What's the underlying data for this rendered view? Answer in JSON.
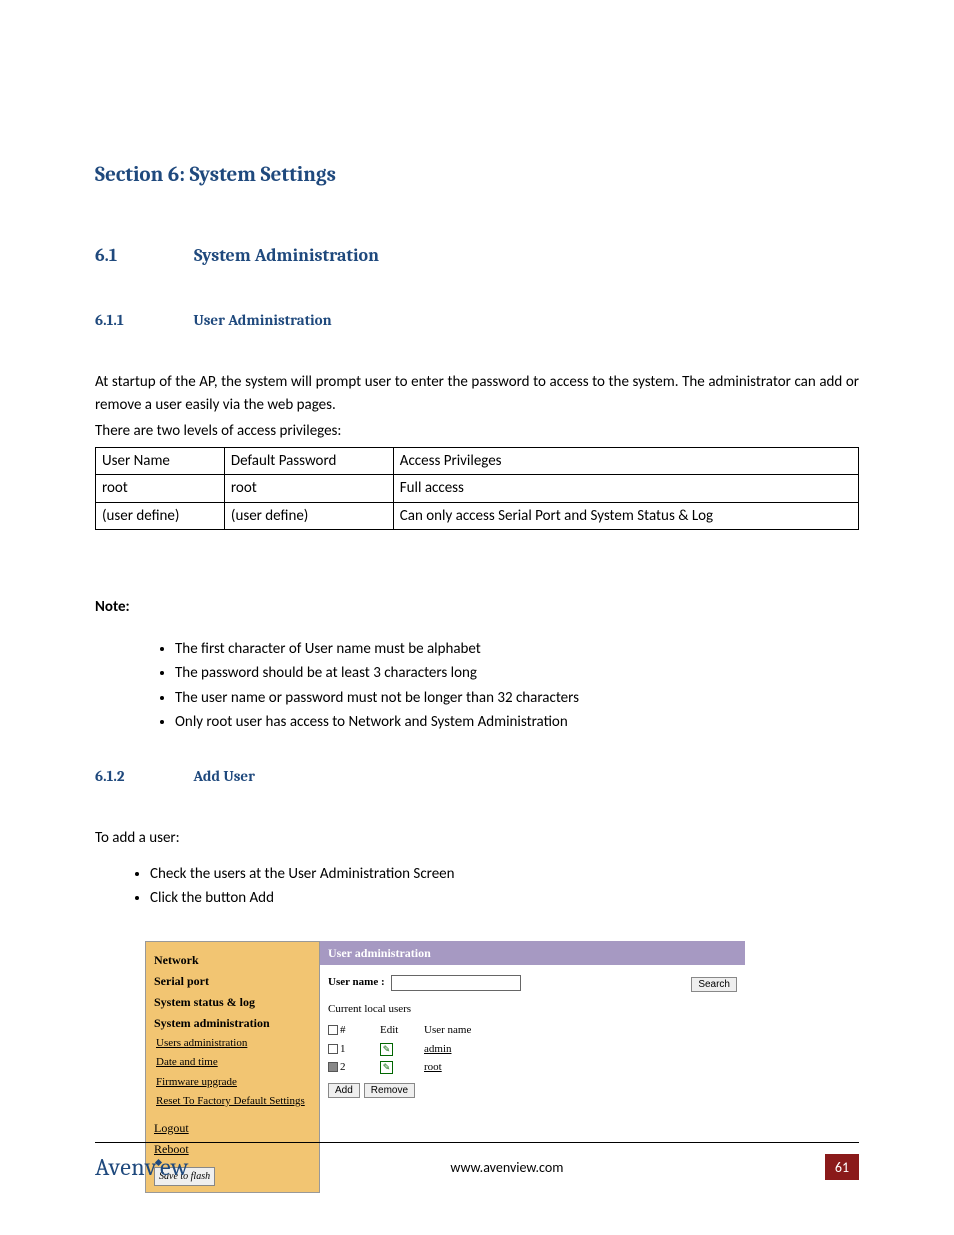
{
  "headings": {
    "section": "Section 6: System Settings",
    "h2num": "6.1",
    "h2txt": "System Administration",
    "h3a_num": "6.1.1",
    "h3a_txt": "User Administration",
    "h3b_num": "6.1.2",
    "h3b_txt": "Add User"
  },
  "paras": {
    "p1": "At startup of the AP, the system will prompt user to enter the password to access to the system. The administrator can add or remove a user easily via the web pages.",
    "p2": "There are two levels of access privileges:",
    "note": "Note:",
    "addIntro": "To add a user:"
  },
  "privTable": {
    "head": [
      "User Name",
      "Default Password",
      "Access Privileges"
    ],
    "rows": [
      [
        "root",
        "root",
        "Full access"
      ],
      [
        "(user define)",
        "(user define)",
        "Can only access Serial Port and System Status & Log"
      ]
    ]
  },
  "notes": [
    "The first character of User name must be alphabet",
    "The password should be at least 3 characters long",
    "The user name or password must not be longer than 32 characters",
    "Only root user has access to Network and System Administration"
  ],
  "addSteps": [
    "Check the users at the User Administration Screen",
    "Click the button Add"
  ],
  "shot": {
    "nav": {
      "network": "Network",
      "serial": "Serial port",
      "status": "System status & log",
      "sysadmin": "System administration",
      "subs": [
        "Users administration",
        "Date and time",
        "Firmware upgrade",
        "Reset To Factory Default Settings"
      ],
      "logout": "Logout",
      "reboot": "Reboot",
      "save": "Save to flash"
    },
    "titlebar": "User administration",
    "search_label": "User name  :",
    "search_btn": "Search",
    "subhead": "Current local users",
    "cols": {
      "num": "#",
      "edit": "Edit",
      "uname": "User name"
    },
    "users": [
      {
        "idx": "1",
        "name": "admin",
        "checked": false
      },
      {
        "idx": "2",
        "name": "root",
        "checked": true
      }
    ],
    "add": "Add",
    "remove": "Remove",
    "edit_glyph": "✎"
  },
  "footer": {
    "brand_a": "Avenv",
    "brand_b": "ew",
    "url": "www.avenview.com",
    "page": "61"
  }
}
